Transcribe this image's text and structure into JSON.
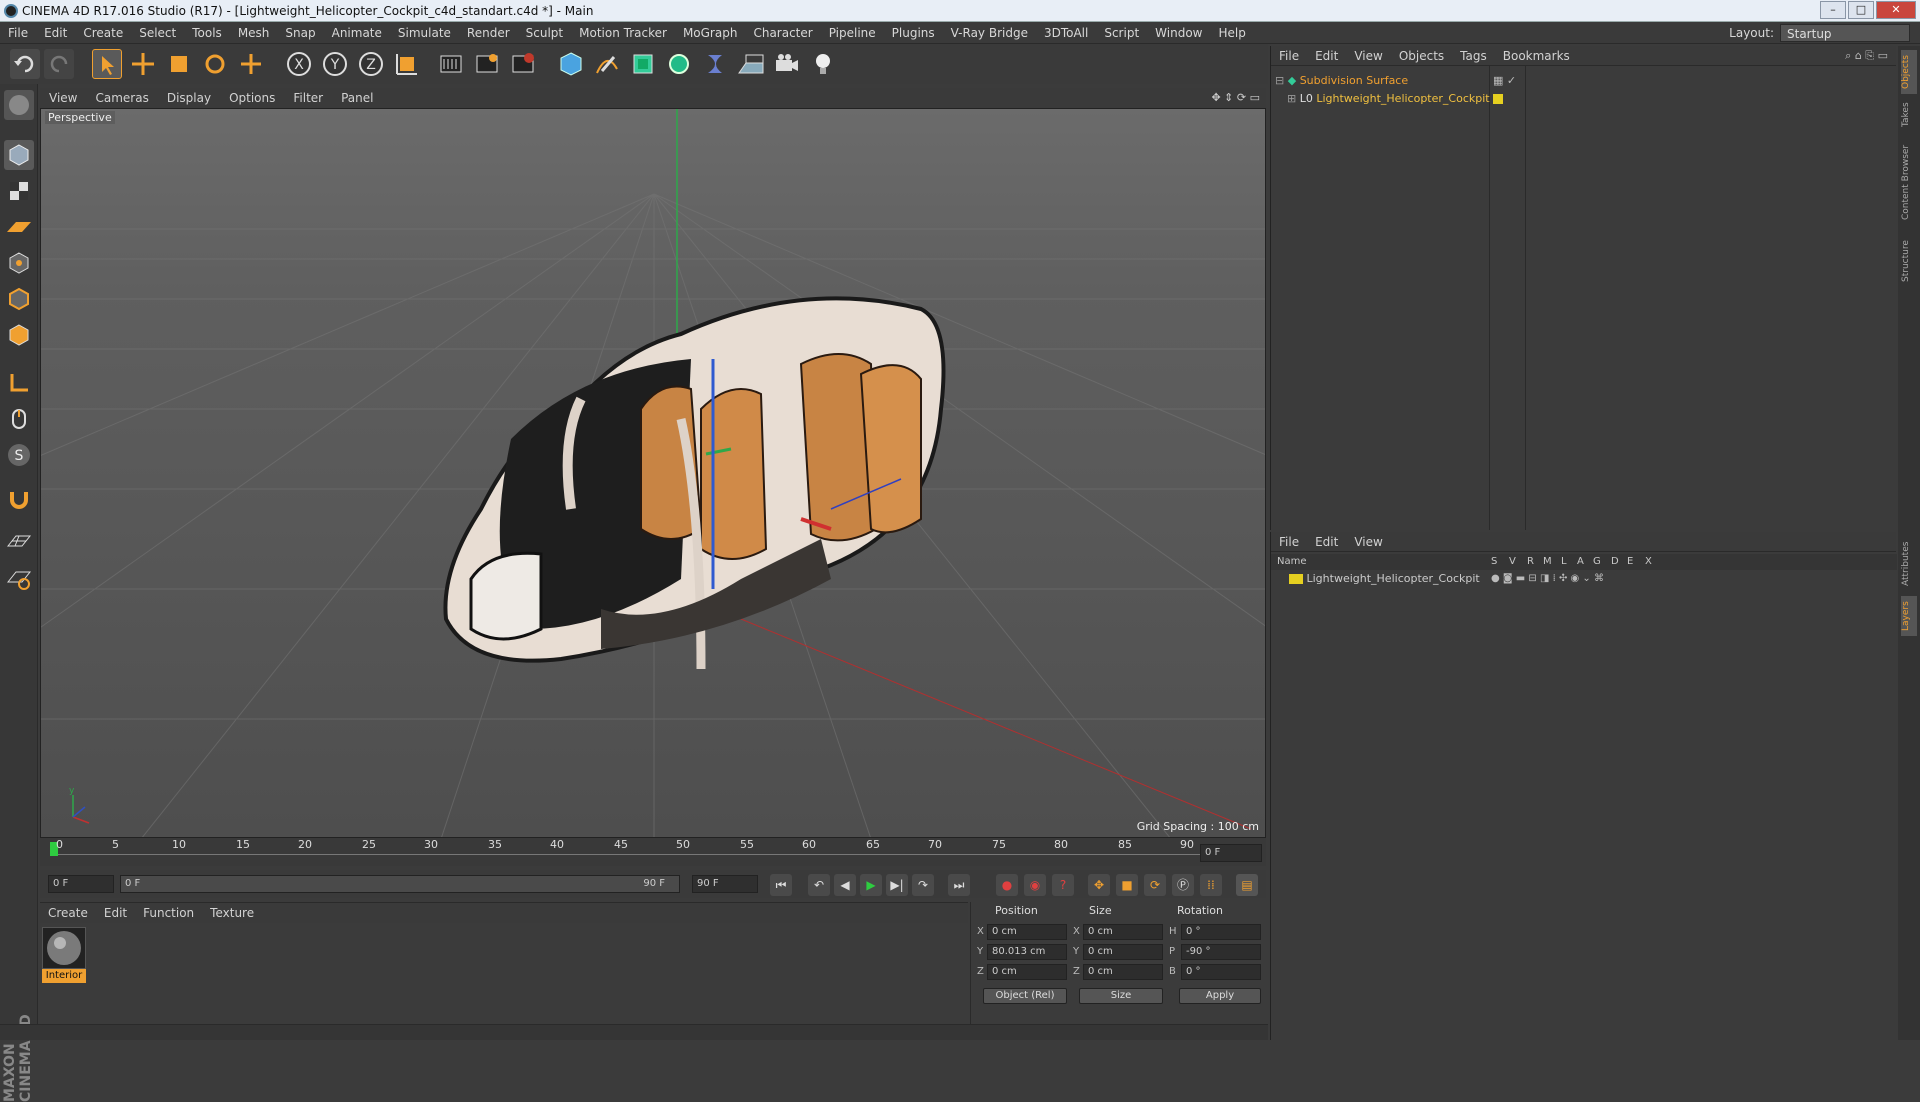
{
  "window": {
    "title": "CINEMA 4D R17.016 Studio (R17) - [Lightweight_Helicopter_Cockpit_c4d_standart.c4d *] - Main"
  },
  "menu": [
    "File",
    "Edit",
    "Create",
    "Select",
    "Tools",
    "Mesh",
    "Snap",
    "Animate",
    "Simulate",
    "Render",
    "Sculpt",
    "Motion Tracker",
    "MoGraph",
    "Character",
    "Pipeline",
    "Plugins",
    "V-Ray Bridge",
    "3DToAll",
    "Script",
    "Window",
    "Help"
  ],
  "layout": {
    "label": "Layout:",
    "value": "Startup"
  },
  "viewport": {
    "menu": [
      "View",
      "Cameras",
      "Display",
      "Options",
      "Filter",
      "Panel"
    ],
    "label": "Perspective",
    "grid_spacing": "Grid Spacing : 100 cm"
  },
  "timeline": {
    "ticks": [
      "0",
      "5",
      "10",
      "15",
      "20",
      "25",
      "30",
      "35",
      "40",
      "45",
      "50",
      "55",
      "60",
      "65",
      "70",
      "75",
      "80",
      "85",
      "90"
    ],
    "current_frame": "0 F",
    "start_field": "0 F",
    "range_start": "0 F",
    "range_end": "90 F",
    "end_field": "90 F"
  },
  "material": {
    "menu": [
      "Create",
      "Edit",
      "Function",
      "Texture"
    ],
    "item_label": "Interior"
  },
  "coords": {
    "headers": [
      "Position",
      "Size",
      "Rotation"
    ],
    "rows": [
      {
        "axis": "X",
        "pos": "0 cm",
        "saxis": "X",
        "size": "0 cm",
        "raxis": "H",
        "rot": "0 °"
      },
      {
        "axis": "Y",
        "pos": "80.013 cm",
        "saxis": "Y",
        "size": "0 cm",
        "raxis": "P",
        "rot": "-90 °"
      },
      {
        "axis": "Z",
        "pos": "0 cm",
        "saxis": "Z",
        "size": "0 cm",
        "raxis": "B",
        "rot": "0 °"
      }
    ],
    "mode": "Object (Rel)",
    "size_mode": "Size",
    "apply": "Apply"
  },
  "objects": {
    "menu": [
      "File",
      "Edit",
      "View",
      "Objects",
      "Tags",
      "Bookmarks"
    ],
    "items": [
      {
        "name": "Subdivision Surface"
      },
      {
        "name": "Lightweight_Helicopter_Cockpit"
      }
    ]
  },
  "layers": {
    "menu": [
      "File",
      "Edit",
      "View"
    ],
    "col_name": "Name",
    "cols": [
      "S",
      "V",
      "R",
      "M",
      "L",
      "A",
      "G",
      "D",
      "E",
      "X"
    ],
    "items": [
      {
        "name": "Lightweight_Helicopter_Cockpit"
      }
    ]
  },
  "sidetabs": [
    "Objects",
    "Takes",
    "Content Browser",
    "Structure",
    "Attributes",
    "Layers"
  ],
  "brand": "MAXON CINEMA 4D",
  "colors": {
    "accent": "#f0a030",
    "selected_obj": "#f0c040",
    "layer": "#e6d020"
  }
}
